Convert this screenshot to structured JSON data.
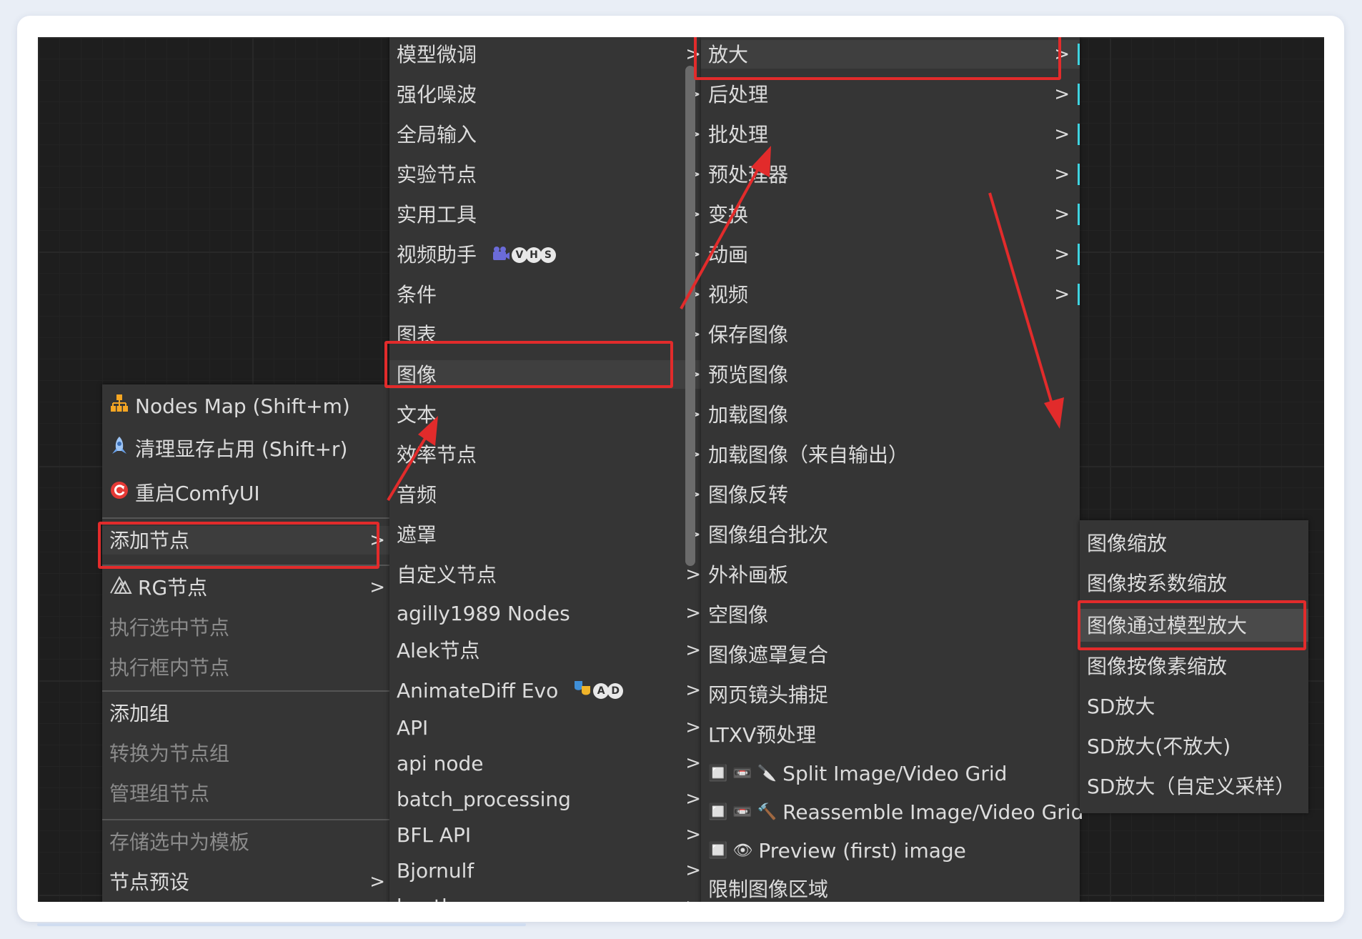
{
  "context_menu": {
    "items": [
      {
        "label": "Nodes Map (Shift+m)",
        "icon": "nodes-map-icon",
        "enabled": true,
        "submenu": false
      },
      {
        "label": "清理显存占用 (Shift+r)",
        "icon": "rocket-icon",
        "enabled": true,
        "submenu": false
      },
      {
        "label": "重启ComfyUI",
        "icon": "restart-icon",
        "enabled": true,
        "submenu": false
      },
      {
        "label": "添加节点",
        "enabled": true,
        "submenu": true,
        "highlighted": true
      },
      {
        "label": "RG节点",
        "icon": "rg-logo-icon",
        "enabled": true,
        "submenu": true
      },
      {
        "label": "执行选中节点",
        "enabled": false,
        "submenu": false
      },
      {
        "label": "执行框内节点",
        "enabled": false,
        "submenu": false
      },
      {
        "label": "添加组",
        "enabled": true,
        "submenu": false
      },
      {
        "label": "转换为节点组",
        "enabled": false,
        "submenu": false
      },
      {
        "label": "管理组节点",
        "enabled": false,
        "submenu": false
      },
      {
        "label": "存储选中为模板",
        "enabled": false,
        "submenu": false
      },
      {
        "label": "节点预设",
        "enabled": true,
        "submenu": true
      }
    ]
  },
  "category_menu": {
    "items": [
      {
        "label": "模型微调"
      },
      {
        "label": "强化噪波"
      },
      {
        "label": "全局输入"
      },
      {
        "label": "实验节点"
      },
      {
        "label": "实用工具"
      },
      {
        "label": "视频助手",
        "badges": [
          "V",
          "H",
          "S"
        ],
        "emoji": "film-icon"
      },
      {
        "label": "条件"
      },
      {
        "label": "图表"
      },
      {
        "label": "图像",
        "highlighted": true
      },
      {
        "label": "文本"
      },
      {
        "label": "效率节点"
      },
      {
        "label": "音频"
      },
      {
        "label": "遮罩"
      },
      {
        "label": "自定义节点"
      },
      {
        "label": "agilly1989 Nodes"
      },
      {
        "label": "Alek节点"
      },
      {
        "label": "AnimateDiff Evo",
        "badges": [
          "A",
          "D"
        ],
        "emoji": "masks-icon"
      },
      {
        "label": "API"
      },
      {
        "label": "api node"
      },
      {
        "label": "batch_processing"
      },
      {
        "label": "BFL API"
      },
      {
        "label": "Bjornulf"
      },
      {
        "label": "bootleg"
      }
    ]
  },
  "image_menu": {
    "items": [
      {
        "label": "放大",
        "submenu": true,
        "highlighted": true
      },
      {
        "label": "后处理",
        "submenu": true
      },
      {
        "label": "批处理",
        "submenu": true
      },
      {
        "label": "预处理器",
        "submenu": true
      },
      {
        "label": "变换",
        "submenu": true
      },
      {
        "label": "动画",
        "submenu": true
      },
      {
        "label": "视频",
        "submenu": true
      },
      {
        "label": "保存图像"
      },
      {
        "label": "预览图像"
      },
      {
        "label": "加载图像"
      },
      {
        "label": "加载图像（来自输出）"
      },
      {
        "label": "图像反转"
      },
      {
        "label": "图像组合批次"
      },
      {
        "label": "外补画板"
      },
      {
        "label": "空图像"
      },
      {
        "label": "图像遮罩复合"
      },
      {
        "label": "网页镜头捕捉"
      },
      {
        "label": "LTXV预处理"
      },
      {
        "label": "Split Image/Video Grid",
        "prefix": "🔲 📼 🔪"
      },
      {
        "label": "Reassemble Image/Video Grid",
        "prefix": "🔲 📼 🔨"
      },
      {
        "label": "Preview (first) image",
        "prefix": "🔲 👁"
      },
      {
        "label": "限制图像区域"
      }
    ]
  },
  "upscale_menu": {
    "items": [
      {
        "label": "图像缩放"
      },
      {
        "label": "图像按系数缩放"
      },
      {
        "label": "图像通过模型放大",
        "highlighted": true
      },
      {
        "label": "图像按像素缩放"
      },
      {
        "label": "SD放大"
      },
      {
        "label": "SD放大(不放大)"
      },
      {
        "label": "SD放大（自定义采样）"
      }
    ]
  },
  "colors": {
    "highlight_box": "#e22b2b",
    "submenu_indicator": "#3fd3e0",
    "menu_bg": "#353535",
    "canvas_bg": "#1e1e1e"
  }
}
